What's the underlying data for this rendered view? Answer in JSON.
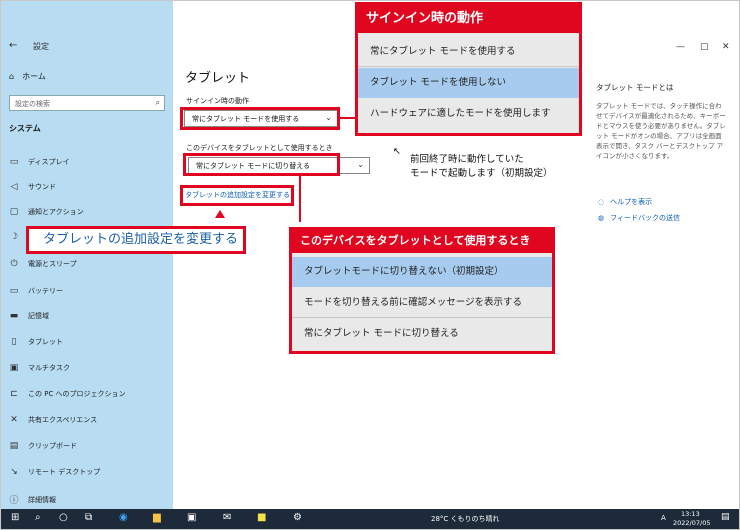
{
  "window": {
    "title": "設定",
    "back_glyph": "←"
  },
  "sidebar": {
    "home_label": "ホーム",
    "search_placeholder": "設定の検索",
    "section": "システム",
    "items": [
      {
        "icon": "display-icon",
        "glyph": "▭",
        "label": "ディスプレイ"
      },
      {
        "icon": "sound-icon",
        "glyph": "◁",
        "label": "サウンド"
      },
      {
        "icon": "notification-icon",
        "glyph": "▢",
        "label": "通知とアクション"
      },
      {
        "icon": "focus-icon",
        "glyph": "☽",
        "label": ""
      },
      {
        "icon": "power-icon",
        "glyph": "⏻",
        "label": "電源とスリープ"
      },
      {
        "icon": "battery-icon",
        "glyph": "▭",
        "label": "バッテリー"
      },
      {
        "icon": "storage-icon",
        "glyph": "▬",
        "label": "記憶域"
      },
      {
        "icon": "tablet-icon",
        "glyph": "▯",
        "label": "タブレット"
      },
      {
        "icon": "multitask-icon",
        "glyph": "▣",
        "label": "マルチタスク"
      },
      {
        "icon": "project-icon",
        "glyph": "⊏",
        "label": "この PC へのプロジェクション"
      },
      {
        "icon": "shared-icon",
        "glyph": "✕",
        "label": "共有エクスペリエンス"
      },
      {
        "icon": "clipboard-icon",
        "glyph": "▤",
        "label": "クリップボード"
      },
      {
        "icon": "remote-icon",
        "glyph": "↘",
        "label": "リモート デスクトップ"
      },
      {
        "icon": "info-icon",
        "glyph": "ⓘ",
        "label": "詳細情報"
      }
    ]
  },
  "main": {
    "title": "タブレット",
    "signin_label": "サインイン時の動作",
    "signin_value": "常にタブレット モードを使用する",
    "device_label": "このデバイスをタブレットとして使用するとき",
    "device_value": "常にタブレット モードに切り替える",
    "more_link": "タブレットの追加設定を変更する"
  },
  "right_panel": {
    "title": "タブレット モードとは",
    "text": "タブレット モードでは、タッチ操作に合わせてデバイスが最適化されるため、キーボードとマウスを使う必要がありません。タブレット モードがオンの場合、アプリは全画面表示で開き、タスク バーとデスクトップ アイコンが小さくなります。",
    "help": "ヘルプを表示",
    "feedback": "フィードバックの送信"
  },
  "callout_signin": {
    "title": "サインイン時の動作",
    "options": [
      "常にタブレット モードを使用する",
      "タブレット モードを使用しない",
      "ハードウェアに適したモードを使用します"
    ],
    "note": "前回終了時に動作していた\nモードで起動します（初期設定）"
  },
  "callout_device": {
    "title": "このデバイスをタブレットとして使用するとき",
    "options": [
      "タブレットモードに切り替えない（初期設定）",
      "モードを切り替える前に確認メッセージを表示する",
      "常にタブレット モードに切り替える"
    ]
  },
  "annotation": "タブレットの追加設定を変更する",
  "taskbar": {
    "weather": "28°C くもりのち晴れ",
    "ime": "A",
    "time": "13:13",
    "date": "2022/07/05"
  },
  "colors": {
    "accent_red": "#e0061f",
    "sidebar": "#b8dcf2",
    "link": "#0a5db6",
    "selected": "#a7cbee"
  }
}
